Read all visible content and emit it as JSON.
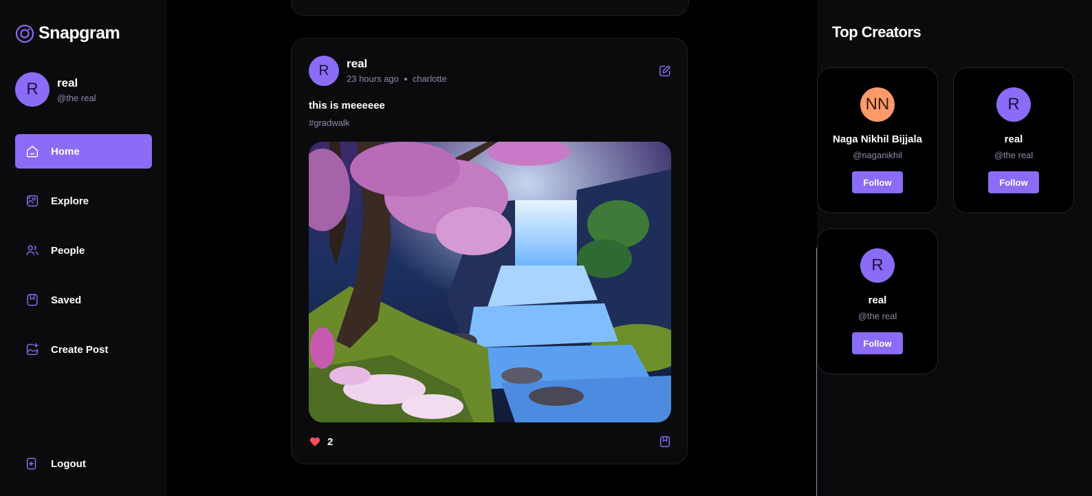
{
  "app": {
    "name": "Snapgram"
  },
  "user": {
    "initial": "R",
    "name": "real",
    "handle": "@the real"
  },
  "nav": {
    "items": [
      {
        "label": "Home",
        "icon": "home-icon",
        "active": true
      },
      {
        "label": "Explore",
        "icon": "explore-icon",
        "active": false
      },
      {
        "label": "People",
        "icon": "people-icon",
        "active": false
      },
      {
        "label": "Saved",
        "icon": "bookmark-icon",
        "active": false
      },
      {
        "label": "Create Post",
        "icon": "create-post-icon",
        "active": false
      }
    ],
    "logout_label": "Logout"
  },
  "post": {
    "author_initial": "R",
    "author": "real",
    "time": "23 hours ago",
    "location": "charlotte",
    "caption": "this is meeeeee",
    "tags": "#gradwalk",
    "likes": "2",
    "image_icon": "waterfall-image"
  },
  "top_creators": {
    "title": "Top Creators",
    "creators": [
      {
        "initial": "NN",
        "name": "Naga Nikhil Bijjala",
        "handle": "@naganikhil",
        "follow_label": "Follow",
        "avatar_color": "#ff9a6b"
      },
      {
        "initial": "R",
        "name": "real",
        "handle": "@the real",
        "follow_label": "Follow",
        "avatar_color": "#8b6cf6"
      },
      {
        "initial": "R",
        "name": "real",
        "handle": "@the real",
        "follow_label": "Follow",
        "avatar_color": "#8b6cf6"
      }
    ]
  },
  "colors": {
    "accent": "#8b6cf6",
    "background": "#000000",
    "surface": "#0b0b0d",
    "muted_text": "#8c8ca8",
    "like": "#ff4d5a"
  }
}
